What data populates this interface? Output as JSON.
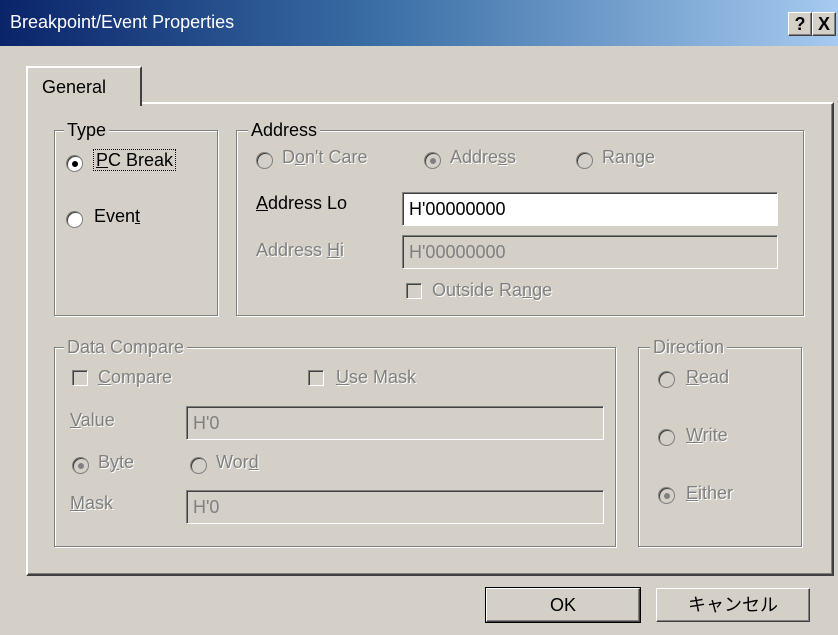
{
  "window": {
    "title": "Breakpoint/Event Properties",
    "help_label": "?",
    "close_label": "X"
  },
  "tabs": [
    {
      "label": "General",
      "selected": true
    }
  ],
  "type_group": {
    "legend": "Type",
    "options": [
      {
        "label_pre": "",
        "label_u": "P",
        "label_post": "C Break",
        "selected": true
      },
      {
        "label_pre": "Even",
        "label_u": "t",
        "label_post": "",
        "selected": false
      }
    ]
  },
  "address_group": {
    "legend": "Address",
    "modes": [
      {
        "label_pre": "D",
        "label_u": "o",
        "label_post": "n't Care",
        "selected": false
      },
      {
        "label_pre": "Addre",
        "label_u": "s",
        "label_post": "s",
        "selected": true
      },
      {
        "label_pre": "Ran",
        "label_u": "g",
        "label_post": "e",
        "selected": false
      }
    ],
    "lo_label_u": "A",
    "lo_label_rest": "ddress Lo",
    "lo_value": "H'00000000",
    "hi_label_pre": "Address ",
    "hi_label_u": "H",
    "hi_label_post": "i",
    "hi_value": "H'00000000",
    "outside_pre": "Outside Ra",
    "outside_u": "n",
    "outside_post": "ge"
  },
  "data_compare": {
    "legend": "Data Compare",
    "compare_u": "C",
    "compare_rest": "ompare",
    "usemask_u": "U",
    "usemask_rest": "se Mask",
    "value_u": "V",
    "value_rest": "alue",
    "value": "H'0",
    "byte_pre": "B",
    "byte_u": "y",
    "byte_post": "te",
    "word_pre": "Wor",
    "word_u": "d",
    "word_post": "",
    "mask_u": "M",
    "mask_rest": "ask",
    "mask_value": "H'0",
    "size_selected": "Byte"
  },
  "direction": {
    "legend": "Direction",
    "read_u": "R",
    "read_rest": "ead",
    "write_u": "W",
    "write_rest": "rite",
    "either_u": "E",
    "either_rest": "ither",
    "selected": "Either"
  },
  "buttons": {
    "ok": "OK",
    "cancel": "キャンセル"
  },
  "colors": {
    "title_start": "#0a246a",
    "title_end": "#a6caf0",
    "face": "#d4d0c8",
    "disabled_text": "#808080"
  }
}
